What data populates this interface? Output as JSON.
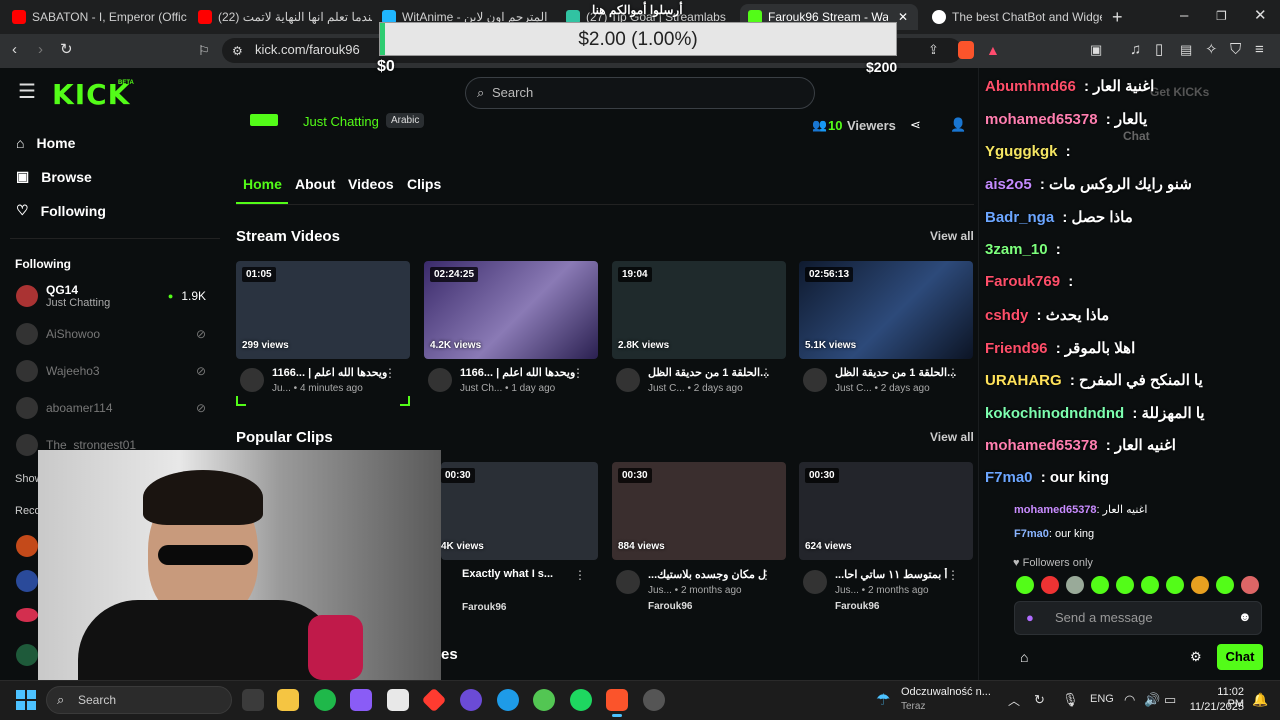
{
  "browser": {
    "tabs": [
      {
        "label": "SABATON - I, Emperor (Offic",
        "color": "#ff0000"
      },
      {
        "label": "(22) عندما تعلم انها النهاية لاتمت",
        "color": "#ff0000"
      },
      {
        "label": "WitAnime - المترجم اون لاين",
        "color": "#1fb6ff"
      },
      {
        "label": "(27) Tip Goal | Streamlabs",
        "color": "#31c3a2"
      },
      {
        "label": "Farouk96 Stream - Watch Li",
        "color": "#53fc18"
      },
      {
        "label": "The best ChatBot and Widgets f",
        "color": "#ffffff"
      }
    ],
    "url": "kick.com/farouk96"
  },
  "tip_goal": {
    "heading": "أرسلوا أموالكم هنا",
    "amount": "$2.00 (1.00%)",
    "min": "$0",
    "max": "$200",
    "progress_pct": 1
  },
  "site": {
    "logo": "KICK",
    "logo_badge": "BETA",
    "search_placeholder": "Search",
    "accent": "#53fc18"
  },
  "sidebar": {
    "nav": [
      {
        "label": "Home",
        "icon": "home-icon"
      },
      {
        "label": "Browse",
        "icon": "browse-icon"
      },
      {
        "label": "Following",
        "icon": "heart-icon"
      }
    ],
    "following_title": "Following",
    "following": [
      {
        "name": "QG14",
        "sub": "Just Chatting",
        "count": "1.9K",
        "live": true
      },
      {
        "name": "AiShowoo",
        "live": false
      },
      {
        "name": "Wajeeho3",
        "live": false
      },
      {
        "name": "aboamer114",
        "live": false
      },
      {
        "name": "The_strongest01",
        "live": false
      }
    ],
    "show_more": "Show",
    "recommended": "Reco"
  },
  "channel": {
    "category": "Just Chatting",
    "language": "Arabic",
    "viewers_count": "10",
    "viewers_label": "Viewers",
    "tabs": [
      "Home",
      "About",
      "Videos",
      "Clips"
    ]
  },
  "stream_videos": {
    "title": "Stream Videos",
    "view_all": "View all",
    "items": [
      {
        "duration": "01:05",
        "views": "299 views",
        "title": "1166... | ويحدها الله اعلم",
        "channel": "Ju...",
        "age": "4 minutes ago",
        "thumb": "#2a3340"
      },
      {
        "duration": "02:24:25",
        "views": "4.2K views",
        "title": "1166... | ويحدها الله اعلم",
        "channel": "Just Ch...",
        "age": "1 day ago",
        "thumb": "#5a4a8a"
      },
      {
        "duration": "19:04",
        "views": "2.8K views",
        "title": "الحلقة 1 من حديقة الظل...",
        "channel": "Just C...",
        "age": "2 days ago",
        "thumb": "#1f2a2c"
      },
      {
        "duration": "02:56:13",
        "views": "5.1K views",
        "title": "الحلقة 1 من حديقة الظل...",
        "channel": "Just C...",
        "age": "2 days ago",
        "thumb": "#1d2b45"
      }
    ]
  },
  "popular_clips": {
    "title": "Popular Clips",
    "view_all": "View all",
    "items": [
      {
        "duration": "00:30",
        "views": "4K views",
        "title": "Exactly what I s...",
        "channel": "Jus...",
        "age": "2 months ago",
        "author": "Farouk96",
        "thumb": "#2a2f36"
      },
      {
        "duration": "00:30",
        "views": "884 views",
        "title": "...ل مكان وجسده بلاستيك",
        "channel": "Jus...",
        "age": "2 months ago",
        "author": "Farouk96",
        "thumb": "#3a2e2e"
      },
      {
        "duration": "00:30",
        "views": "624 views",
        "title": "...أ بمتوسط ١١ ساتي احا",
        "channel": "Jus...",
        "age": "2 months ago",
        "author": "Farouk96",
        "thumb": "#23252b"
      }
    ],
    "partial_heading": "es"
  },
  "chat_overlay": [
    {
      "user": "Abumhmd66",
      "color": "#ff4f6a",
      "text": "اغنية العار"
    },
    {
      "user": "mohamed65378",
      "color": "#ff7fb0",
      "text": "يالعار"
    },
    {
      "user": "Yguggkgk",
      "color": "#f5e663",
      "text": ""
    },
    {
      "user": "ais2o5",
      "color": "#c48bff",
      "text": "شنو رايك الروكس مات"
    },
    {
      "user": "Badr_nga",
      "color": "#6ca6ff",
      "text": "ماذا حصل"
    },
    {
      "user": "3zam_10",
      "color": "#7dff7d",
      "text": ""
    },
    {
      "user": "Farouk769",
      "color": "#ff4f6a",
      "text": ""
    },
    {
      "user": "cshdy",
      "color": "#ff4f6a",
      "text": "ماذا يحدث"
    },
    {
      "user": "Friend96",
      "color": "#ff4f6a",
      "text": "اهلا بالموقر"
    },
    {
      "user": "URAHARG",
      "color": "#ffe25a",
      "text": "يا المنكح في المفرح"
    },
    {
      "user": "kokochinodndndnd",
      "color": "#7dffb0",
      "text": "يا المهزللة"
    },
    {
      "user": "mohamed65378",
      "color": "#ff7fb0",
      "text": "اغنيه العار"
    },
    {
      "user": "F7ma0",
      "color": "#6ca6ff",
      "text": "our king"
    }
  ],
  "chat": {
    "get_kicks": "Get KICKs",
    "header": "Chat",
    "bottom_messages": [
      {
        "user": "mohamed65378",
        "color": "#c98cff",
        "text": "اغنيه العار"
      },
      {
        "user": "F7ma0",
        "color": "#8ab4ff",
        "text": "our king"
      }
    ],
    "followers_only": "Followers only",
    "input_placeholder": "Send a message",
    "send_label": "Chat"
  },
  "taskbar": {
    "search": "Search",
    "weather": "Odczuwalność n...",
    "weather_sub": "Teraz",
    "lang": "ENG",
    "time": "11:02 PM",
    "date": "11/21/2025"
  }
}
